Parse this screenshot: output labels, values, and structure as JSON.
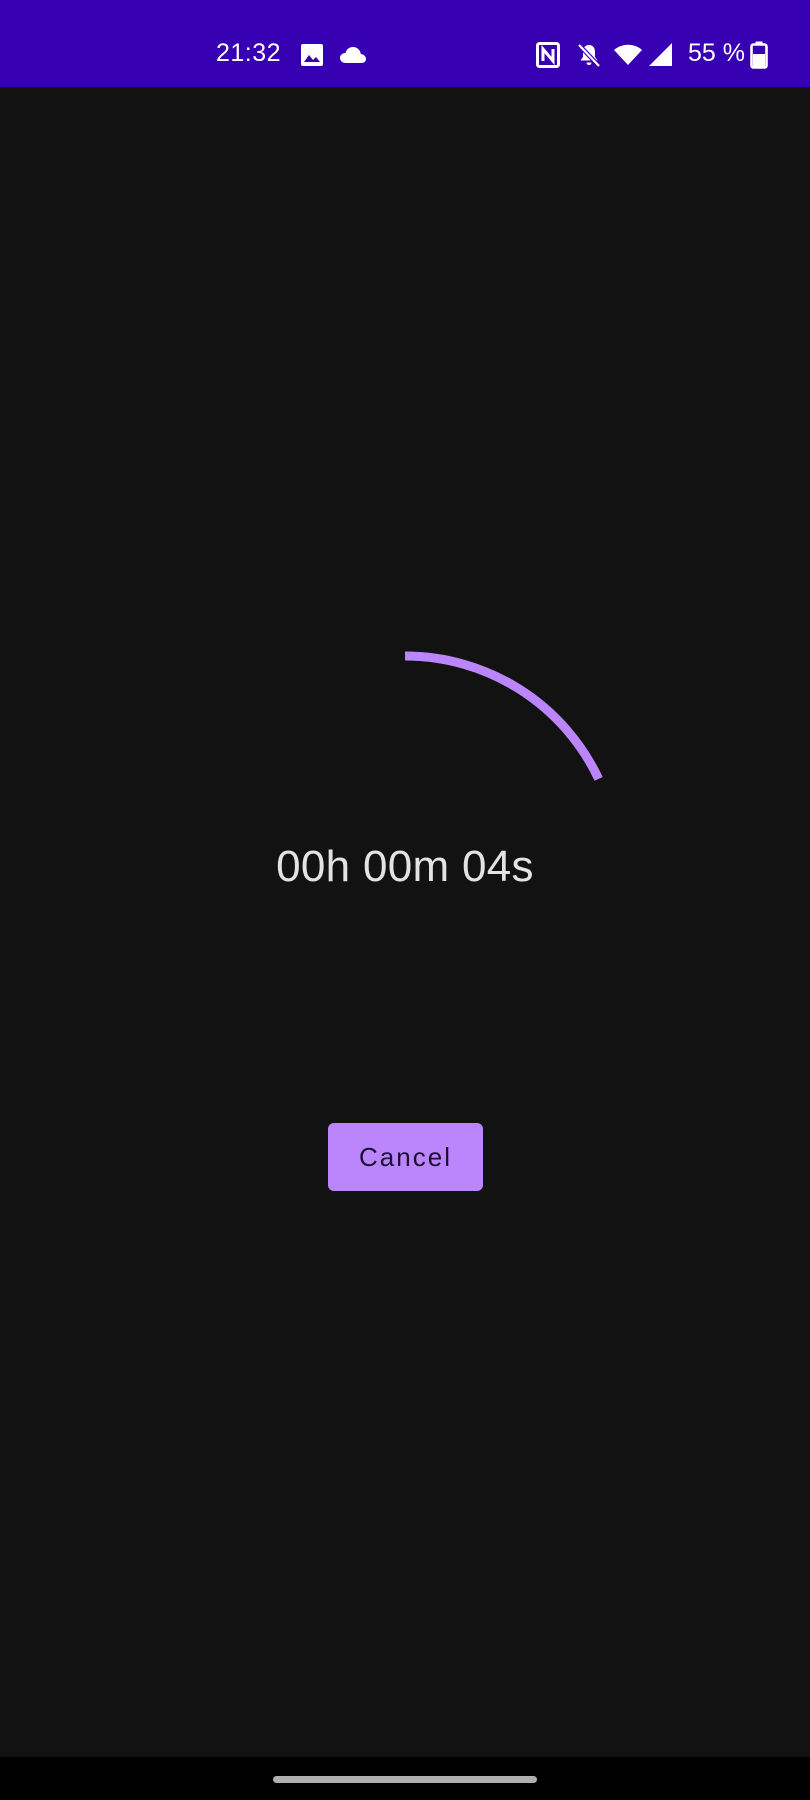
{
  "status_bar": {
    "time": "21:32",
    "battery_text": "55 %",
    "background_color": "#3700b3",
    "icons_left": [
      "image-icon",
      "cloud-icon"
    ],
    "icons_right": [
      "nfc-icon",
      "notifications-off-icon",
      "wifi-icon",
      "signal-icon",
      "battery-icon"
    ]
  },
  "timer": {
    "display": "00h 00m 04s",
    "progress_fraction": 0.18,
    "progress_color": "#bb86fc"
  },
  "actions": {
    "cancel_label": "Cancel",
    "cancel_color": "#bb86fc"
  },
  "theme": {
    "background": "#121212",
    "text": "#e3e3e3"
  }
}
